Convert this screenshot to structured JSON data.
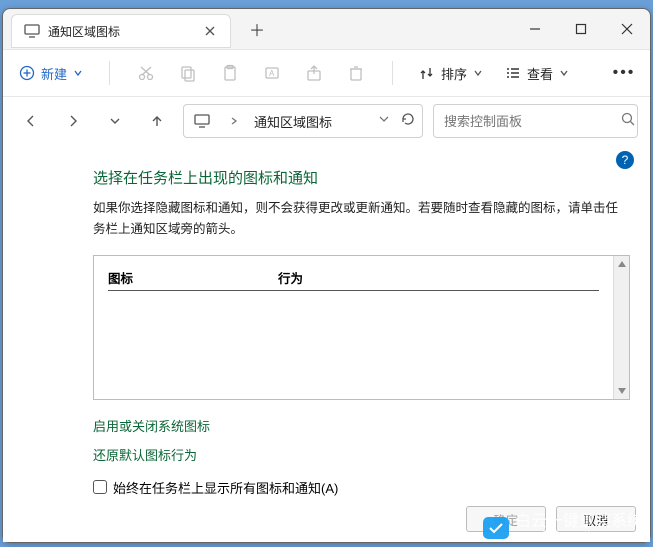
{
  "window": {
    "tab_title": "通知区域图标",
    "new_tab_tooltip": "+"
  },
  "toolbar": {
    "new_label": "新建",
    "sort_label": "排序",
    "view_label": "查看"
  },
  "address": {
    "location": "通知区域图标"
  },
  "search": {
    "placeholder": "搜索控制面板"
  },
  "page": {
    "heading": "选择在任务栏上出现的图标和通知",
    "description": "如果你选择隐藏图标和通知，则不会获得更改或更新通知。若要随时查看隐藏的图标，请单击任务栏上通知区域旁的箭头。",
    "table": {
      "col_icon": "图标",
      "col_behavior": "行为"
    },
    "link_system_icons": "启用或关闭系统图标",
    "link_restore_defaults": "还原默认图标行为",
    "checkbox_always_show": "始终在任务栏上显示所有图标和通知(A)"
  },
  "buttons": {
    "ok": "确定",
    "cancel": "取消"
  },
  "watermark": {
    "text": "白云一键重装系统",
    "sub": "www.baiyunxitong.com"
  }
}
